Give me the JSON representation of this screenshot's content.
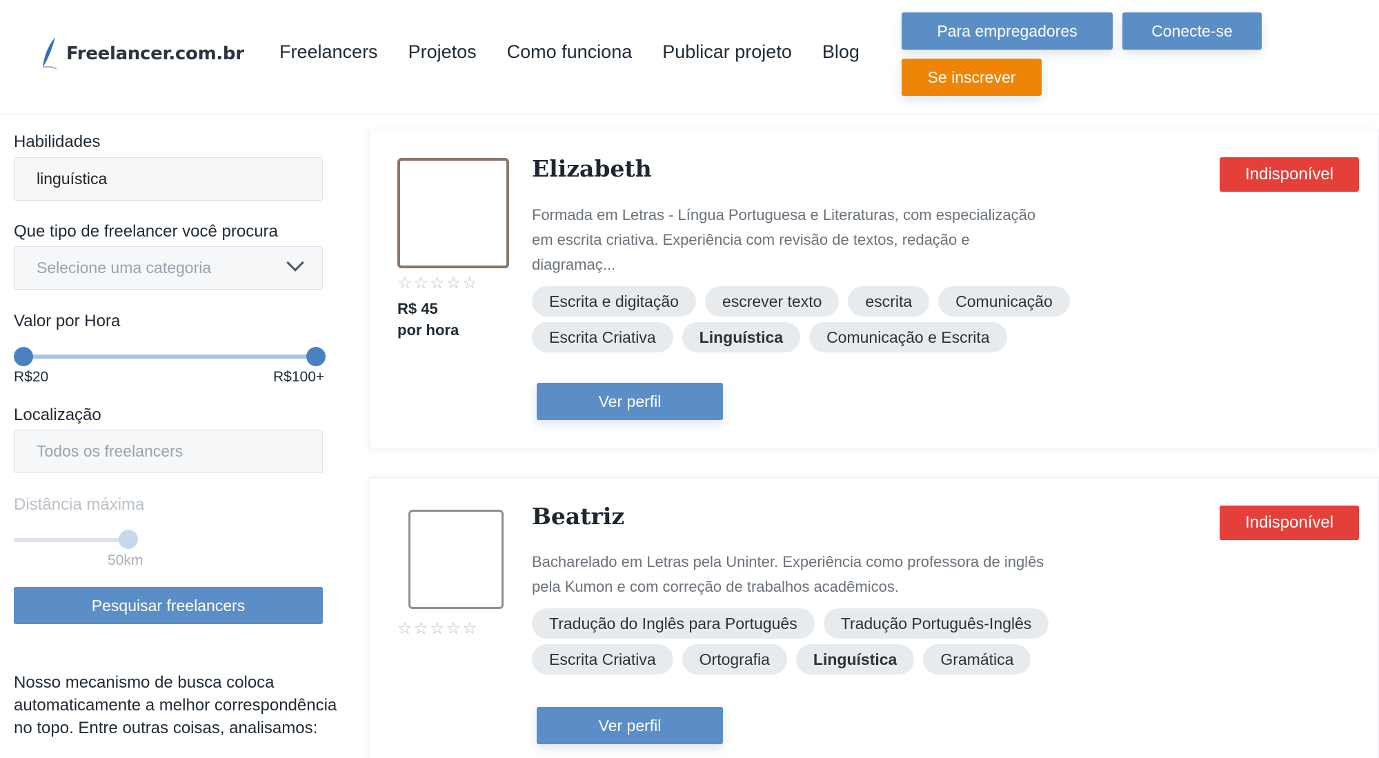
{
  "header": {
    "logo_text": "Freelancer.com.br",
    "nav": [
      "Freelancers",
      "Projetos",
      "Como funciona",
      "Publicar projeto",
      "Blog"
    ],
    "employers_button": "Para empregadores",
    "login_button": "Conecte-se",
    "signup_button": "Se inscrever"
  },
  "filters": {
    "skills_label": "Habilidades",
    "skills_value": "linguística",
    "category_label": "Que tipo de freelancer você procura",
    "category_placeholder": "Selecione uma categoria",
    "rate_label": "Valor por Hora",
    "rate_min": "R$20",
    "rate_max": "R$100+",
    "location_label": "Localização",
    "location_placeholder": "Todos os freelancers",
    "distance_label": "Distância máxima",
    "distance_value": "50km",
    "search_button": "Pesquisar freelancers",
    "note": "Nosso mecanismo de busca coloca automaticamente a melhor correspondência no topo. Entre outras coisas, analisamos:"
  },
  "freelancers": [
    {
      "name": "Elizabeth",
      "status": "Indisponível",
      "description": "Formada em Letras - Língua Portuguesa e Literaturas, com especialização em escrita criativa. Experiência com revisão de textos, redação e diagramaç...",
      "stars": "☆☆☆☆☆",
      "rate": "R$ 45",
      "rate_unit": "por hora",
      "tags": [
        "Escrita e digitação",
        "escrever texto",
        "escrita",
        "Comunicação",
        "Escrita Criativa",
        "Linguística",
        "Comunicação e Escrita"
      ],
      "button": "Ver perfil"
    },
    {
      "name": "Beatriz",
      "status": "Indisponível",
      "description": "Bacharelado em Letras pela Uninter. Experiência como professora de inglês pela Kumon e com correção de trabalhos acadêmicos.",
      "stars": "☆☆☆☆☆",
      "tags": [
        "Tradução do Inglês para Português",
        "Tradução Português-Inglês",
        "Escrita Criativa",
        "Ortografia",
        "Linguística",
        "Gramática"
      ],
      "button": "Ver perfil"
    }
  ],
  "colors": {
    "primary": "#5b8ec6",
    "signup": "#ef8506",
    "unavailable": "#e53f3a",
    "tag_bg": "#e8ebee"
  },
  "icons": [
    "feather-logo-icon",
    "chevron-down-icon",
    "star-icon"
  ]
}
